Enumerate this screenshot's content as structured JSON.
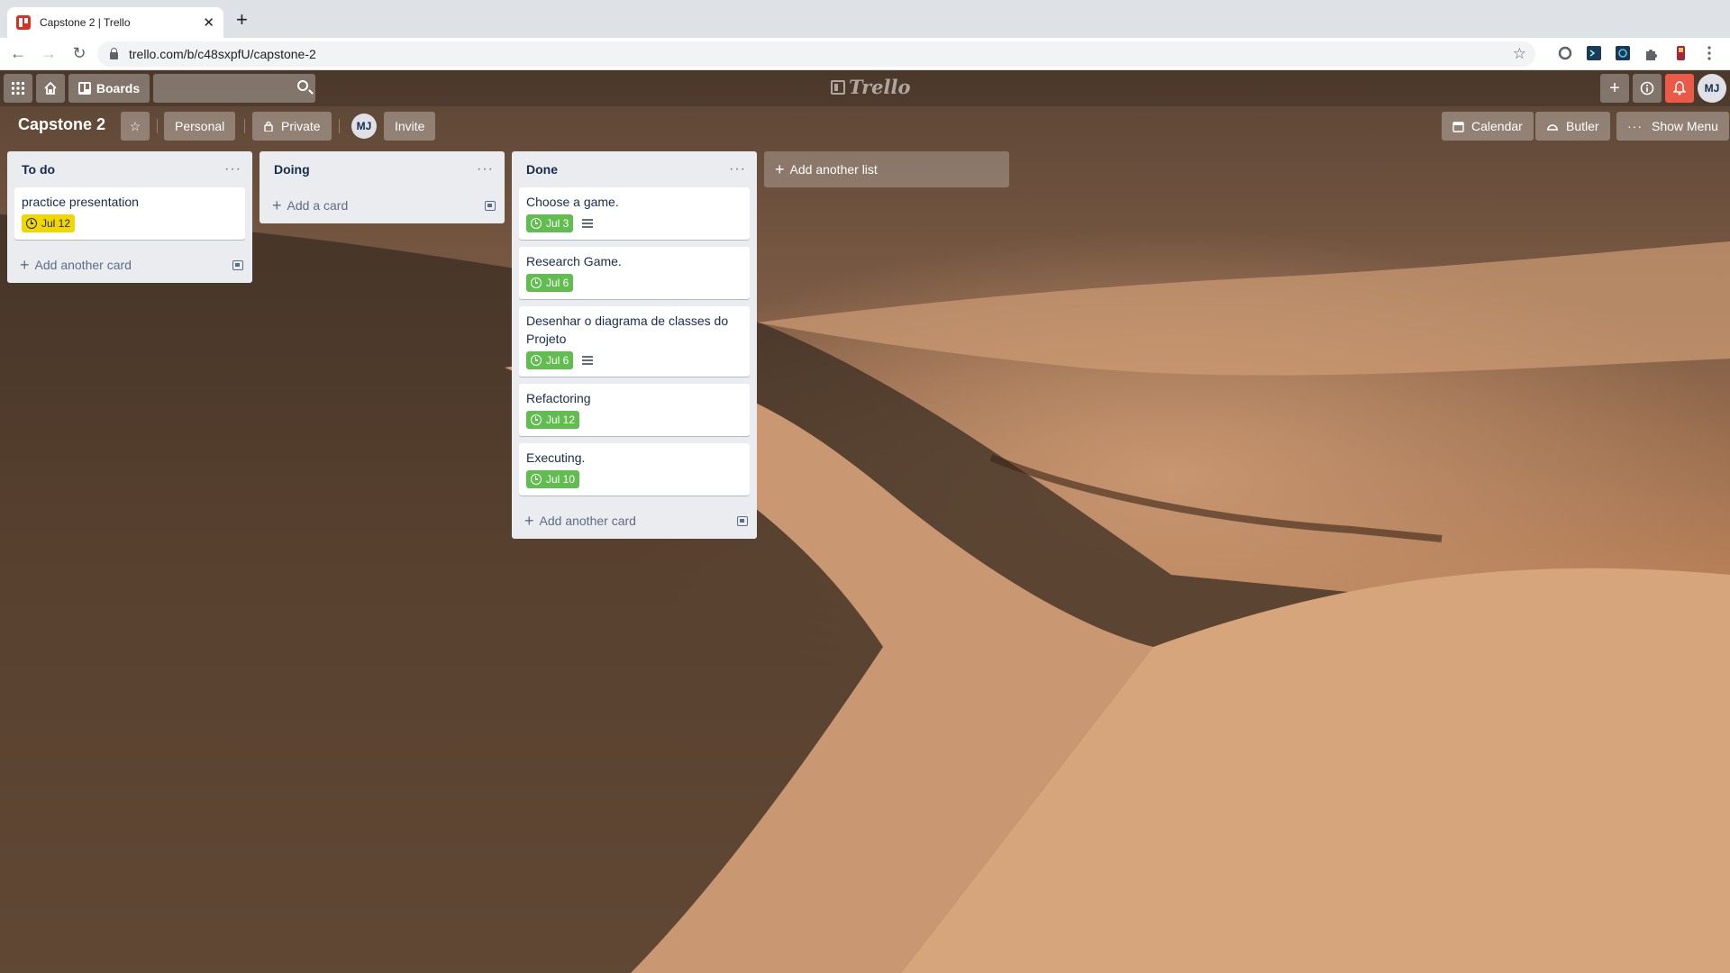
{
  "browser": {
    "tab_title": "Capstone 2 | Trello",
    "url": "trello.com/b/c48sxpfU/capstone-2"
  },
  "trello": {
    "header": {
      "boards_label": "Boards",
      "logo_text": "Trello",
      "user_initials": "MJ"
    },
    "board": {
      "title": "Capstone 2",
      "workspace_label": "Personal",
      "visibility_label": "Private",
      "member_initials": "MJ",
      "invite_label": "Invite",
      "calendar_label": "Calendar",
      "butler_label": "Butler",
      "show_menu_label": "Show Menu"
    },
    "lists": [
      {
        "title": "To do",
        "footer": "Add another card",
        "cards": [
          {
            "title": "practice presentation",
            "due": "Jul 12",
            "due_color": "#f2d600",
            "description": false
          }
        ]
      },
      {
        "title": "Doing",
        "footer": "Add a card",
        "cards": []
      },
      {
        "title": "Done",
        "footer": "Add another card",
        "cards": [
          {
            "title": "Choose a game.",
            "due": "Jul 3",
            "due_color": "#61bd4f",
            "description": true
          },
          {
            "title": "Research Game.",
            "due": "Jul 6",
            "due_color": "#61bd4f",
            "description": false
          },
          {
            "title": "Desenhar o diagrama de classes do Projeto",
            "due": "Jul 6",
            "due_color": "#61bd4f",
            "description": true
          },
          {
            "title": "Refactoring",
            "due": "Jul 12",
            "due_color": "#61bd4f",
            "description": false
          },
          {
            "title": "Executing.",
            "due": "Jul 10",
            "due_color": "#61bd4f",
            "description": false
          }
        ]
      }
    ],
    "add_list_label": "Add another list"
  }
}
